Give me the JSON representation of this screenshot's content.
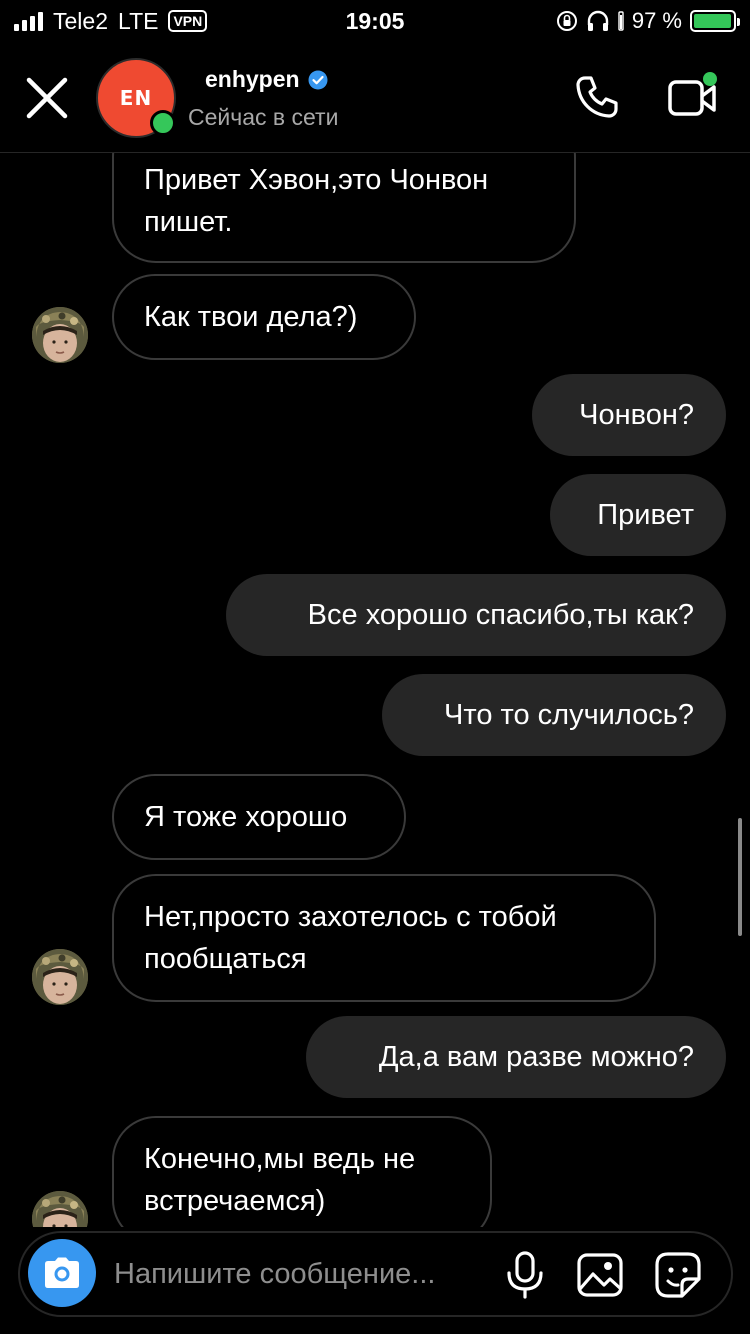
{
  "status_bar": {
    "carrier": "Tele2",
    "network": "LTE",
    "vpn": "VPN",
    "time": "19:05",
    "battery_percent": "97 %",
    "battery_level": 0.97,
    "battery_color": "#34c759"
  },
  "header": {
    "avatar_logo": "EN",
    "name": "enhypen",
    "status": "Сейчас в сети",
    "avatar_color": "#ef4a31",
    "online_color": "#35c75a"
  },
  "messages": [
    {
      "side": "in",
      "text": "Привет Хэвон,это Чонвон\nпишет."
    },
    {
      "side": "in",
      "text": "Как твои дела?)"
    },
    {
      "side": "out",
      "text": "Чонвон?"
    },
    {
      "side": "out",
      "text": "Привет"
    },
    {
      "side": "out",
      "text": "Все хорошо спасибо,ты как?"
    },
    {
      "side": "out",
      "text": "Что то случилось?"
    },
    {
      "side": "in",
      "text": "Я тоже хорошо"
    },
    {
      "side": "in",
      "text": "Нет,просто захотелось с тобой\nпообщаться"
    },
    {
      "side": "out",
      "text": "Да,а вам разве можно?"
    },
    {
      "side": "in",
      "text": "Конечно,мы ведь не\nвстречаемся)"
    }
  ],
  "composer": {
    "placeholder": "Напишите сообщение..."
  },
  "colors": {
    "outgoing_bubble": "#262626",
    "incoming_border": "#3a3a3a",
    "camera_button": "#3797f0"
  }
}
